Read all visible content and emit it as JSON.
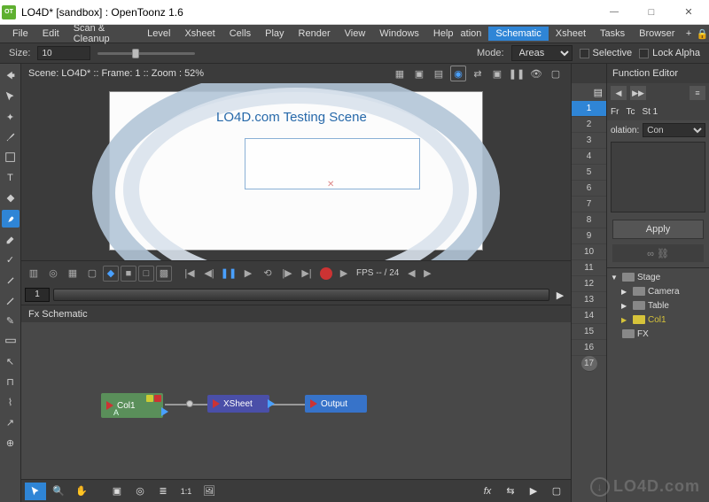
{
  "window": {
    "title": "LO4D* [sandbox] : OpenToonz 1.6"
  },
  "menubar": {
    "items": [
      "File",
      "Edit",
      "Scan & Cleanup",
      "Level",
      "Xsheet",
      "Cells",
      "Play",
      "Render",
      "View",
      "Windows",
      "Help"
    ],
    "right_items": [
      "ation",
      "Schematic",
      "Xsheet",
      "Tasks",
      "Browser"
    ],
    "active_right_index": 1
  },
  "optbar": {
    "size_label": "Size:",
    "size_value": "10",
    "mode_label": "Mode:",
    "mode_value": "Areas",
    "selective_label": "Selective",
    "lockalpha_label": "Lock Alpha"
  },
  "scenebar": {
    "text": "Scene: LO4D*  ::  Frame: 1  ::  Zoom : 52%"
  },
  "canvas": {
    "heading": "LO4D.com Testing Scene"
  },
  "playbar": {
    "fps_text": "FPS -- / 24"
  },
  "timeline": {
    "frame": "1"
  },
  "schematic": {
    "title": "Fx Schematic",
    "nodes": {
      "col1": "Col1",
      "col1_sub": "A",
      "xsheet": "XSheet",
      "output": "Output"
    },
    "toolbar_fx": "fx",
    "toolbar_11": "1:1"
  },
  "numbers": [
    "1",
    "2",
    "3",
    "4",
    "5",
    "6",
    "7",
    "8",
    "9",
    "10",
    "11",
    "12",
    "13",
    "14",
    "15",
    "16",
    "17"
  ],
  "numbers_selected_index": 0,
  "rpanel": {
    "title": "Function Editor",
    "tabs": [
      "Fr",
      "Tc",
      "St 1"
    ],
    "interp_label": "olation:",
    "interp_value": "Con",
    "apply_label": "Apply",
    "tree": {
      "stage": "Stage",
      "camera": "Camera",
      "table": "Table",
      "col1": "Col1",
      "fx": "FX"
    }
  },
  "watermark": "LO4D.com"
}
